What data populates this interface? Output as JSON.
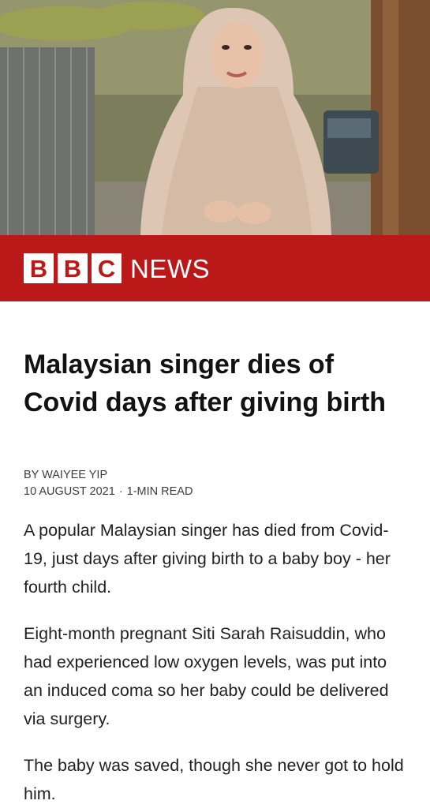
{
  "brand": {
    "letters": [
      "B",
      "B",
      "C"
    ],
    "news": "NEWS",
    "colors": {
      "red": "#bb1919",
      "white": "#ffffff"
    }
  },
  "hero_image": {
    "subject": "woman-in-beige-hijab",
    "icon": "photo-icon"
  },
  "article": {
    "headline": "Malaysian singer dies of Covid days after giving birth",
    "byline": {
      "author": "BY WAIYEE YIP",
      "date": "10 AUGUST 2021",
      "separator": "·",
      "read_time": "1-MIN READ"
    },
    "paragraphs": [
      "A popular Malaysian singer has died from Covid-19, just days after giving birth to a baby boy - her fourth child.",
      "Eight-month pregnant Siti Sarah Raisuddin, who had experienced low oxygen levels, was put into an induced coma so her baby could be delivered via surgery.",
      "The baby was saved, though she never got to hold him."
    ]
  }
}
